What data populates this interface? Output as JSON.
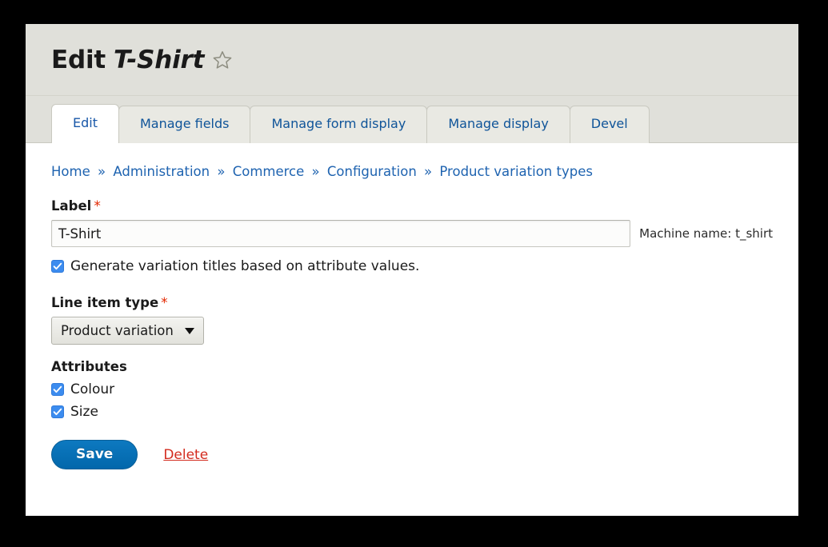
{
  "header": {
    "title_prefix": "Edit",
    "title_entity": "T-Shirt",
    "star_icon": "star-outline-icon"
  },
  "tabs": [
    {
      "label": "Edit",
      "active": true
    },
    {
      "label": "Manage fields",
      "active": false
    },
    {
      "label": "Manage form display",
      "active": false
    },
    {
      "label": "Manage display",
      "active": false
    },
    {
      "label": "Devel",
      "active": false
    }
  ],
  "breadcrumb": {
    "separator": "»",
    "items": [
      "Home",
      "Administration",
      "Commerce",
      "Configuration",
      "Product variation types"
    ]
  },
  "form": {
    "label_field": {
      "label": "Label",
      "required_marker": "*",
      "value": "T-Shirt",
      "placeholder": "",
      "machine_name_text": "Machine name: t_shirt"
    },
    "generate_titles": {
      "label": "Generate variation titles based on attribute values.",
      "checked": true
    },
    "line_item_type": {
      "label": "Line item type",
      "required_marker": "*",
      "selected": "Product variation"
    },
    "attributes": {
      "heading": "Attributes",
      "items": [
        {
          "label": "Colour",
          "checked": true
        },
        {
          "label": "Size",
          "checked": true
        }
      ]
    }
  },
  "actions": {
    "save_label": "Save",
    "delete_label": "Delete"
  },
  "colors": {
    "accent_blue": "#0267ab",
    "link_blue": "#1e63b0",
    "required_red": "#e32700",
    "delete_red": "#d32b1e",
    "checkbox_blue": "#3c8cef",
    "header_bg": "#e0e0da"
  }
}
